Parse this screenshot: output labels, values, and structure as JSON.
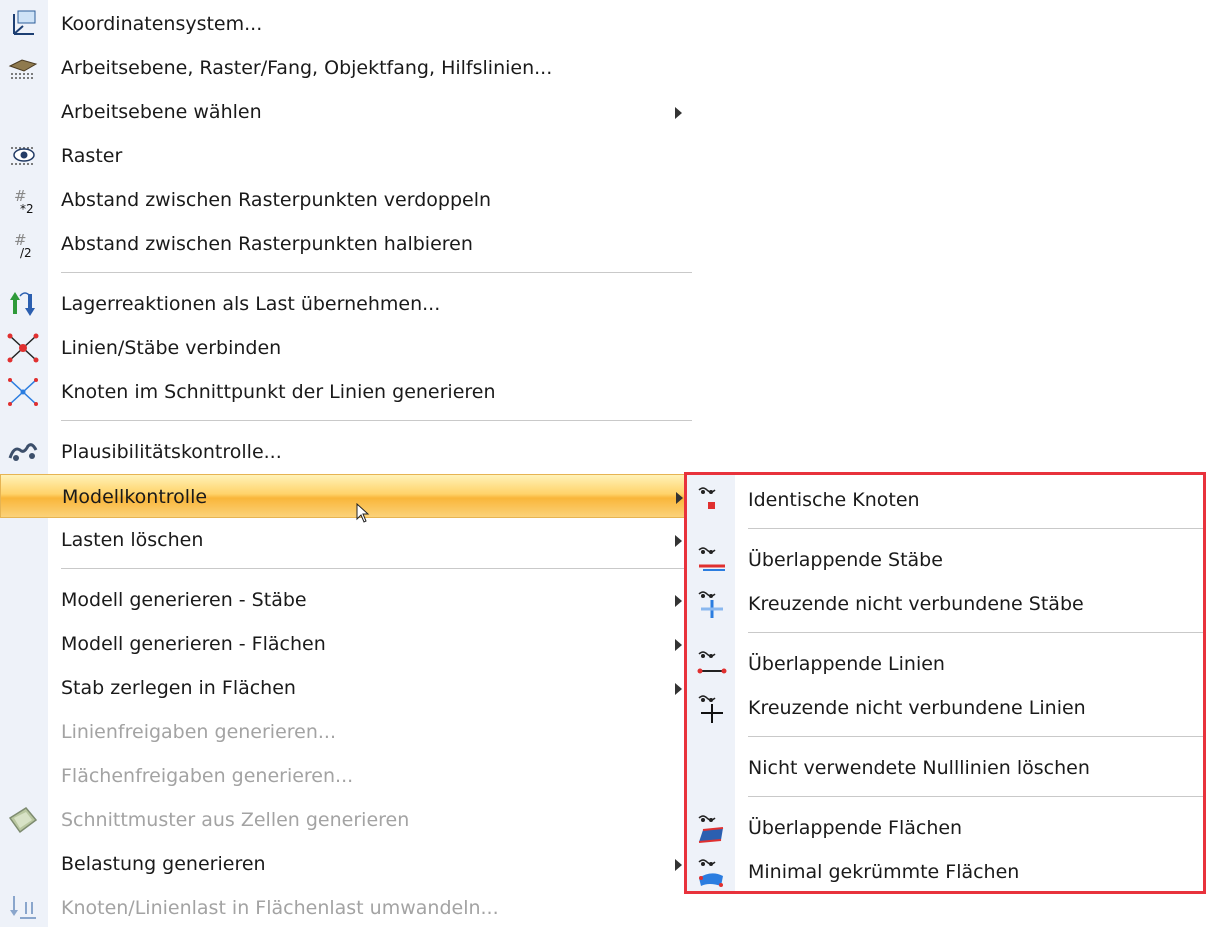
{
  "menu": {
    "items": [
      {
        "label": "Koordinatensystem...",
        "icon": "coordinate-system-icon"
      },
      {
        "label": "Arbeitsebene, Raster/Fang, Objektfang, Hilfslinien...",
        "icon": "work-plane-icon"
      },
      {
        "label": "Arbeitsebene wählen",
        "submenu": true
      },
      {
        "label": "Raster",
        "icon": "grid-eye-icon"
      },
      {
        "label": "Abstand zwischen Rasterpunkten verdoppeln",
        "icon": "grid-double-icon"
      },
      {
        "label": "Abstand zwischen Rasterpunkten halbieren",
        "icon": "grid-half-icon"
      },
      {
        "label": "Lagerreaktionen als Last übernehmen...",
        "icon": "support-reactions-icon"
      },
      {
        "label": "Linien/Stäbe verbinden",
        "icon": "connect-lines-icon"
      },
      {
        "label": "Knoten im Schnittpunkt der Linien generieren",
        "icon": "intersection-nodes-icon"
      },
      {
        "label": "Plausibilitätskontrolle...",
        "icon": "plausibility-check-icon"
      },
      {
        "label": "Modellkontrolle",
        "submenu": true,
        "highlighted": true
      },
      {
        "label": "Lasten löschen",
        "submenu": true
      },
      {
        "label": "Modell generieren - Stäbe",
        "submenu": true
      },
      {
        "label": "Modell generieren - Flächen",
        "submenu": true
      },
      {
        "label": "Stab zerlegen in Flächen",
        "submenu": true
      },
      {
        "label": "Linienfreigaben generieren...",
        "disabled": true
      },
      {
        "label": "Flächenfreigaben generieren...",
        "disabled": true
      },
      {
        "label": "Schnittmuster aus Zellen generieren",
        "disabled": true,
        "icon": "cutting-pattern-icon"
      },
      {
        "label": "Belastung generieren",
        "submenu": true
      },
      {
        "label": "Knoten/Linienlast in Flächenlast umwandeln...",
        "disabled": true,
        "icon": "convert-load-icon"
      }
    ]
  },
  "submenu": {
    "items": [
      {
        "label": "Identische Knoten",
        "icon": "identical-nodes-icon"
      },
      {
        "label": "Überlappende Stäbe",
        "icon": "overlapping-members-icon"
      },
      {
        "label": "Kreuzende nicht verbundene Stäbe",
        "icon": "crossing-members-icon"
      },
      {
        "label": "Überlappende Linien",
        "icon": "overlapping-lines-icon"
      },
      {
        "label": "Kreuzende nicht verbundene Linien",
        "icon": "crossing-lines-icon"
      },
      {
        "label": "Nicht verwendete Nulllinien löschen"
      },
      {
        "label": "Überlappende Flächen",
        "icon": "overlapping-surfaces-icon"
      },
      {
        "label": "Minimal gekrümmte Flächen",
        "icon": "minimally-curved-surfaces-icon"
      }
    ]
  }
}
